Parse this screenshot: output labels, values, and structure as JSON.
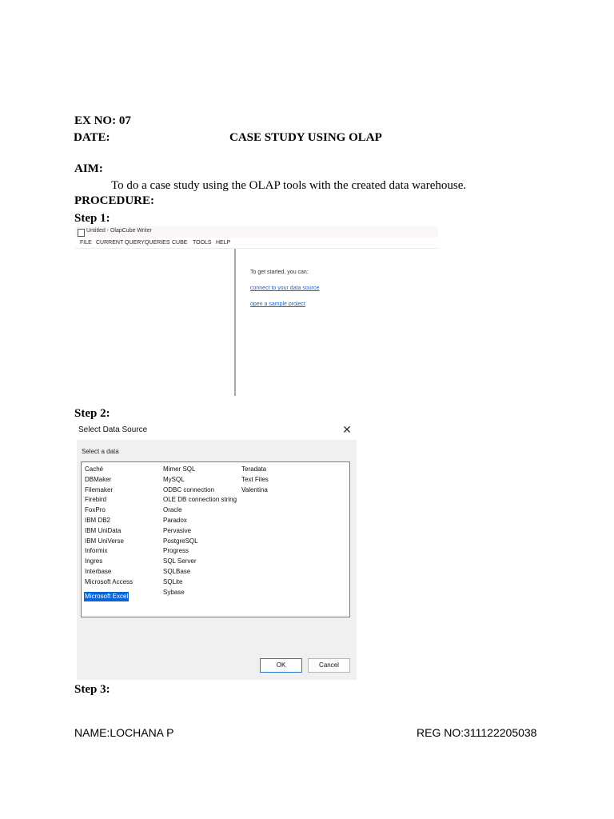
{
  "header": {
    "ex_no": "EX NO: 07",
    "date": "DATE:",
    "title": "CASE STUDY USING OLAP"
  },
  "aim": {
    "heading": "AIM:",
    "text": "To do a case study using the OLAP tools with the created data warehouse."
  },
  "procedure": {
    "heading": "PROCEDURE:",
    "step1": "Step 1:",
    "step2": "Step 2:",
    "step3": "Step 3:"
  },
  "screenshot1": {
    "window_title": "Untitled - OlapCube Writer",
    "menu": [
      "FILE",
      "CURRENT QUERY",
      "QUERIES",
      "CUBE",
      "TOOLS",
      "HELP"
    ],
    "intro": "To get started, you can:",
    "links": [
      "connect to your data source",
      "open a sample project"
    ]
  },
  "screenshot2": {
    "dialog_title": "Select Data Source",
    "close_glyph": "✕",
    "prompt": "Select a data",
    "columns": [
      [
        "Caché",
        "DBMaker",
        "Filemaker",
        "Firebird",
        "FoxPro",
        "IBM DB2",
        "IBM UniData",
        "IBM UniVerse",
        "Informix",
        "Ingres",
        "Interbase",
        "Microsoft Access",
        "Microsoft Excel"
      ],
      [
        "Mimer SQL",
        "MySQL",
        "ODBC connection",
        "OLE DB connection string",
        "Oracle",
        "Paradox",
        "Pervasive",
        "PostgreSQL",
        "Progress",
        "SQL Server",
        "SQLBase",
        "SQLite",
        "Sybase"
      ],
      [
        "Teradata",
        "Text Files",
        "Valentina"
      ]
    ],
    "selected": "Microsoft Excel",
    "ok_label": "OK",
    "cancel_label": "Cancel"
  },
  "footer": {
    "name": "NAME:LOCHANA P",
    "reg_no": "REG NO:311122205038"
  }
}
